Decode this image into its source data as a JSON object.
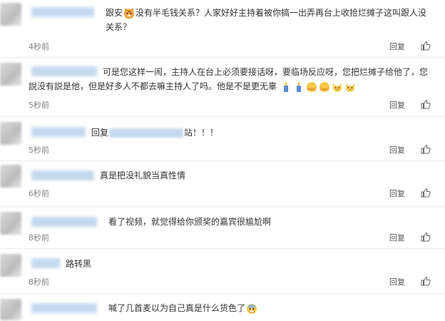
{
  "comments": [
    {
      "segments": [
        "跟安",
        "没有半毛钱关系？人家好好主持着被你搞一出弄再台上收拾烂摊子这叫跟人没关系？"
      ],
      "time": "4秒前",
      "reply": "回复"
    },
    {
      "text": "可是您这样一闹，主持人在台上必须要接话呀，要临场反应呀，您把烂摊子给他了，您說没有説是他，但是好多人不都去嘛主持人了吗。他是不是更无辜",
      "time": "5秒前",
      "reply": "回复"
    },
    {
      "prefix": "回复",
      "suffix": "站！！！",
      "time": "5秒前",
      "reply": "回复"
    },
    {
      "text": "真是把没礼貌当真性情",
      "time": "6秒前",
      "reply": "回复"
    },
    {
      "text": "看了视频，就觉得给你颁奖的嘉宾很尴尬啊",
      "time": "8秒前",
      "reply": "回复"
    },
    {
      "text": "路转黑",
      "time": "8秒前",
      "reply": "回复"
    },
    {
      "text": "喊了几首麦以为自己真是什么货色了"
    }
  ],
  "icons": {
    "like": "thumbs-up-icon",
    "emoji_row": [
      "candle-icon",
      "candle-icon",
      "hug-emoji-icon",
      "hug-emoji-icon",
      "cat-emoji-icon",
      "cat-emoji-icon"
    ],
    "inline_emoji": "tiger-emoji-icon",
    "end_emoji": "scared-emoji-icon"
  },
  "colors": {
    "link": "#5a87c5",
    "text": "#333333",
    "meta": "#808080"
  }
}
